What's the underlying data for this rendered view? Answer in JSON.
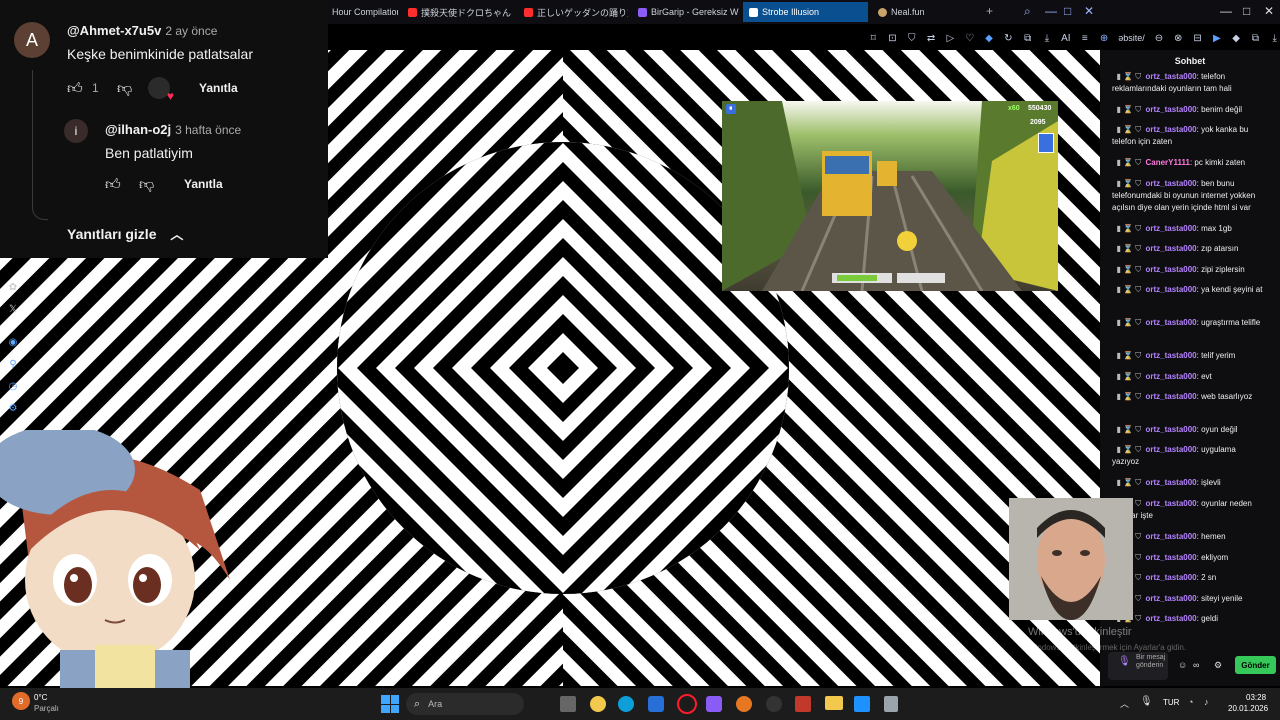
{
  "browser": {
    "tabs": [
      {
        "label": "Hour Compilation",
        "color": "#cfd3dc"
      },
      {
        "label": "撲殺天使ドクロちゃん - Yo",
        "color": "#ff2d2d"
      },
      {
        "label": "正しいゲッダンの踊り方 - Y",
        "color": "#ff2d2d"
      },
      {
        "label": "BirGarip - Gereksiz W",
        "color": "#8b5cf6"
      },
      {
        "label": "Strobe Illusion",
        "color": "#ffffff"
      },
      {
        "label": "Neal.fun",
        "color": "#c9a36a"
      }
    ],
    "new_tab": "+",
    "url_fragment": "əbsite/",
    "ai_label": "AI"
  },
  "comments": {
    "top": {
      "avatar_letter": "A",
      "handle": "@Ahmet-x7u5v",
      "ago": "2 ay önce",
      "text": "Keşke benimkinide patlatsalar",
      "likes": "1",
      "reply_label": "Yanıtla"
    },
    "reply": {
      "avatar_letter": "i",
      "handle": "@ilhan-o2j",
      "ago": "3 hafta önce",
      "text": "Ben patlatiyim",
      "reply_label": "Yanıtla"
    },
    "hide_replies": "Yanıtları gizle"
  },
  "game": {
    "multiplier": "x60",
    "score": "550430",
    "coins": "2095"
  },
  "chat": {
    "title": "Sohbet",
    "messages": [
      {
        "user": "ortz_tasta000",
        "text": "telefon reklamlarındaki oyunların tam hali",
        "alt": false
      },
      {
        "user": "ortz_tasta000",
        "text": "benim değil",
        "alt": false
      },
      {
        "user": "ortz_tasta000",
        "text": "yok kanka bu telefon için zaten",
        "alt": false
      },
      {
        "user": "CanerY1111",
        "text": "pc kimki zaten",
        "alt": true
      },
      {
        "user": "ortz_tasta000",
        "text": "ben bunu telefonumdaki bi oyunun internet yokken açılsın diye olan yerin içinde html si var",
        "alt": false
      },
      {
        "user": "ortz_tasta000",
        "text": "max 1gb",
        "alt": false
      },
      {
        "user": "ortz_tasta000",
        "text": "zıp atarsın",
        "alt": false
      },
      {
        "user": "ortz_tasta000",
        "text": "zipi ziplersin",
        "alt": false
      },
      {
        "user": "ortz_tasta000",
        "text": "ya kendi şeyini at",
        "alt": false
      },
      {
        "user": "ortz_tasta000",
        "text": "ugraştırma telifle",
        "alt": false
      },
      {
        "user": "ortz_tasta000",
        "text": "telif yerim",
        "alt": false
      },
      {
        "user": "ortz_tasta000",
        "text": "evt",
        "alt": false
      },
      {
        "user": "ortz_tasta000",
        "text": "web tasarlıyoz",
        "alt": false
      },
      {
        "user": "ortz_tasta000",
        "text": "oyun değil",
        "alt": false
      },
      {
        "user": "ortz_tasta000",
        "text": "uygulama yazıyoz",
        "alt": false
      },
      {
        "user": "ortz_tasta000",
        "text": "işlevli",
        "alt": false
      },
      {
        "user": "ortz_tasta000",
        "text": "oyunlar neden oyunlar işte",
        "alt": false
      },
      {
        "user": "ortz_tasta000",
        "text": "hemen",
        "alt": false
      },
      {
        "user": "ortz_tasta000",
        "text": "ekliyom",
        "alt": false
      },
      {
        "user": "ortz_tasta000",
        "text": "2 sn",
        "alt": false
      },
      {
        "user": "ortz_tasta000",
        "text": "siteyi yenile",
        "alt": false
      },
      {
        "user": "ortz_tasta000",
        "text": "geldi",
        "alt": false
      }
    ],
    "input_placeholder": "Bir mesaj gönderin",
    "send_label": "Gönder"
  },
  "watermark": {
    "line1": "Windows'u Etkinleştir",
    "line2": "Windows'u etkinleştirmek için Ayarlar'a gidin."
  },
  "taskbar": {
    "weather_temp": "0°C",
    "weather_desc": "Parçalı",
    "weather_badge": "9",
    "search_placeholder": "Ara",
    "lang": "TUR",
    "time": "03:28",
    "date": "20.01.2026"
  }
}
